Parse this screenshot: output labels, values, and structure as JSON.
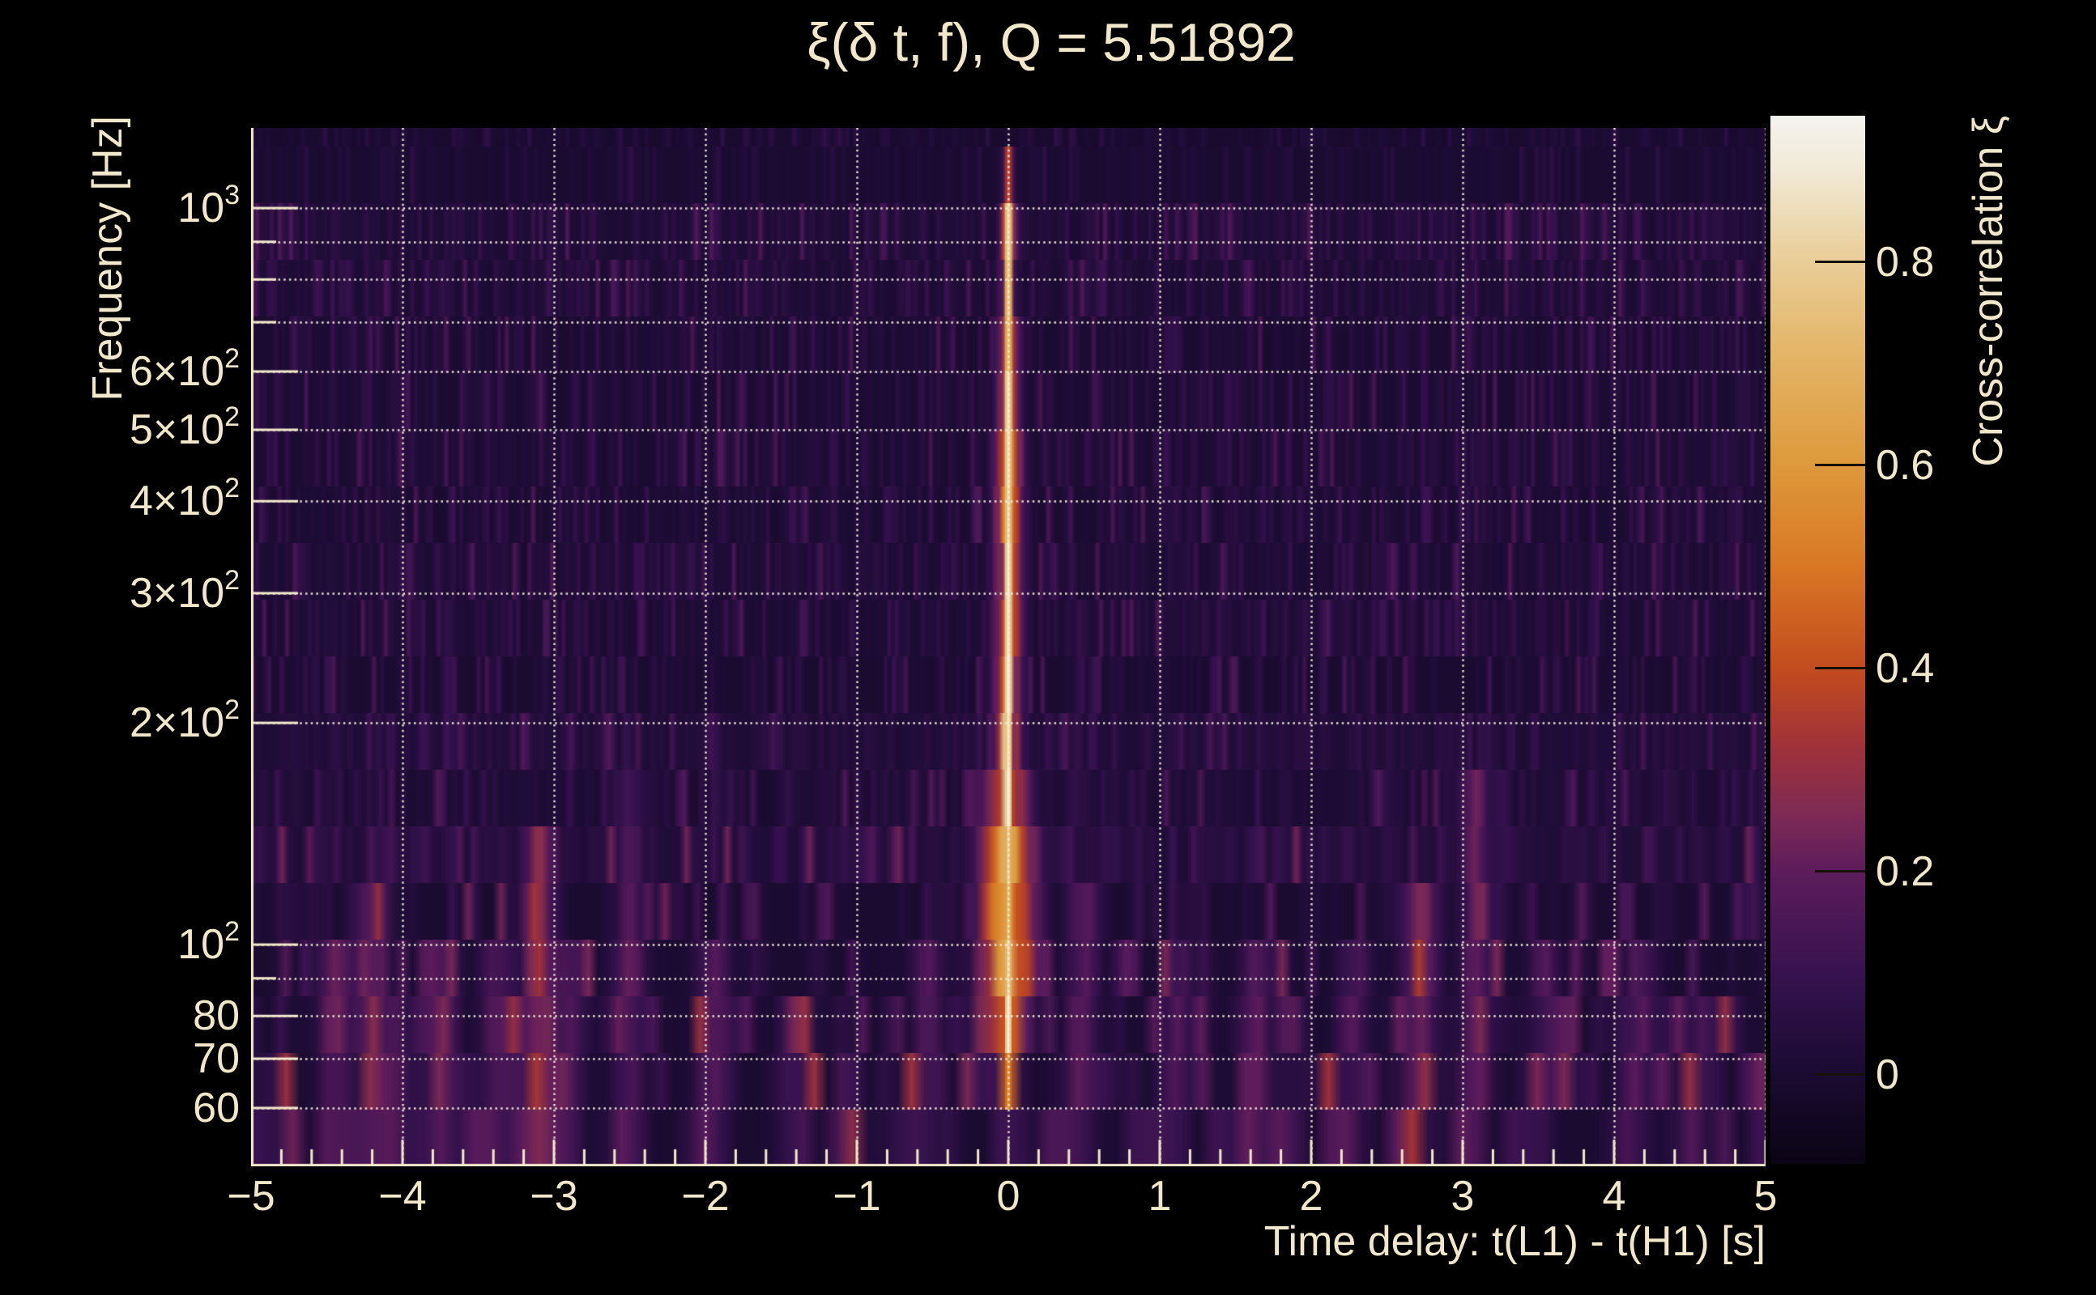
{
  "title": {
    "text": "ξ(δ t, f), Q = 5.51892"
  },
  "axes": {
    "x": {
      "label": "Time delay: t(L1) - t(H1) [s]",
      "range": [
        -5,
        5
      ],
      "minor_step": 0.2,
      "ticks": [
        {
          "label": "−5",
          "value": -5
        },
        {
          "label": "−4",
          "value": -4
        },
        {
          "label": "−3",
          "value": -3
        },
        {
          "label": "−2",
          "value": -2
        },
        {
          "label": "−1",
          "value": -1
        },
        {
          "label": "0",
          "value": 0
        },
        {
          "label": "1",
          "value": 1
        },
        {
          "label": "2",
          "value": 2
        },
        {
          "label": "3",
          "value": 3
        },
        {
          "label": "4",
          "value": 4
        },
        {
          "label": "5",
          "value": 5
        }
      ]
    },
    "y": {
      "label": "Frequency [Hz]",
      "scale": "log",
      "range_hz": [
        50,
        1285
      ],
      "tick_labels": [
        {
          "text": "10",
          "exp": "3",
          "value": 1000
        },
        {
          "text": "6×10",
          "exp": "2",
          "value": 600
        },
        {
          "text": "5×10",
          "exp": "2",
          "value": 500
        },
        {
          "text": "4×10",
          "exp": "2",
          "value": 400
        },
        {
          "text": "3×10",
          "exp": "2",
          "value": 300
        },
        {
          "text": "2×10",
          "exp": "2",
          "value": 200
        },
        {
          "text": "10",
          "exp": "2",
          "value": 100
        },
        {
          "text": "80",
          "value": 80
        },
        {
          "text": "70",
          "value": 70
        },
        {
          "text": "60",
          "value": 60
        }
      ],
      "grid_values": [
        60,
        70,
        80,
        90,
        100,
        200,
        300,
        400,
        500,
        600,
        700,
        800,
        900,
        1000
      ]
    }
  },
  "colorbar": {
    "title": "Cross-correlation ξ",
    "range": [
      -0.088,
      0.944
    ],
    "ticks": [
      {
        "label": "0.8",
        "value": 0.8
      },
      {
        "label": "0.6",
        "value": 0.6
      },
      {
        "label": "0.4",
        "value": 0.4
      },
      {
        "label": "0.2",
        "value": 0.2
      },
      {
        "label": "0",
        "value": 0
      }
    ],
    "colormap": [
      [
        0.0,
        "#0a0414"
      ],
      [
        0.1,
        "#1e0c36"
      ],
      [
        0.18,
        "#36124e"
      ],
      [
        0.28,
        "#5d1c5c"
      ],
      [
        0.33,
        "#7c2a55"
      ],
      [
        0.4,
        "#a03239"
      ],
      [
        0.47,
        "#c24b1f"
      ],
      [
        0.57,
        "#d97724"
      ],
      [
        0.67,
        "#de9a3c"
      ],
      [
        0.77,
        "#e3b466"
      ],
      [
        0.86,
        "#e9cd96"
      ],
      [
        0.95,
        "#f1ead8"
      ],
      [
        1.0,
        "#f5f3ef"
      ]
    ]
  },
  "chart_data": {
    "type": "heatmap",
    "title": "ξ(δ t, f), Q = 5.51892",
    "q_value": 5.51892,
    "xlabel": "Time delay: t(L1) - t(H1) [s]",
    "ylabel": "Frequency [Hz]",
    "x_range_s": [
      -5,
      5
    ],
    "y_range_hz": [
      50,
      1285
    ],
    "y_scale": "log",
    "z_label": "Cross-correlation ξ",
    "z_range": [
      -0.088,
      0.944
    ],
    "grid": "dotted, at integer time delays and decade-multiple frequencies",
    "colormap_name": "black→purple→magenta→red→orange→tan→cream (inferno-like)",
    "rows_per_decade_log_step": 0.0769,
    "main_peak": {
      "t": 0.0,
      "xi_max": 0.93,
      "core_half_width_s": 0.025,
      "f_core_hz": [
        70,
        950
      ],
      "f_faint_hz": [
        950,
        1150
      ],
      "halo": [
        {
          "f_lt": 160,
          "w": 0.17,
          "amp": 0.42
        },
        {
          "f_lt": 350,
          "w": 0.11,
          "amp": 0.4
        },
        {
          "f_lt": 700,
          "w": 0.085,
          "amp": 0.38
        },
        {
          "f_lt": 2000,
          "w": 0.055,
          "amp": 0.28
        }
      ],
      "bright_bands_hz": [
        [
          90,
          140
        ],
        [
          380,
          520
        ],
        [
          800,
          950
        ]
      ]
    },
    "noise_floor": {
      "xi_typical": [
        0.0,
        0.15
      ],
      "low_freq_boost_below_hz": 160
    },
    "secondary_stripes": [
      {
        "t": -4.45,
        "amp": 0.3,
        "f_max": 100
      },
      {
        "t": -4.2,
        "amp": 0.34,
        "f_max": 115
      },
      {
        "t": -4.05,
        "amp": 0.26,
        "f_max": 85
      },
      {
        "t": -3.75,
        "amp": 0.28,
        "f_max": 100
      },
      {
        "t": -3.37,
        "amp": 0.24,
        "f_max": 90
      },
      {
        "t": -3.1,
        "amp": 0.42,
        "f_max": 130
      },
      {
        "t": -2.92,
        "amp": 0.27,
        "f_max": 95
      },
      {
        "t": -2.5,
        "amp": 0.22,
        "f_max": 160
      },
      {
        "t": -1.95,
        "amp": 0.24,
        "f_max": 90
      },
      {
        "t": -1.38,
        "amp": 0.2,
        "f_max": 85
      },
      {
        "t": -0.52,
        "amp": 0.22,
        "f_max": 100
      },
      {
        "t": 0.5,
        "amp": 0.26,
        "f_max": 110
      },
      {
        "t": 1.12,
        "amp": 0.2,
        "f_max": 90
      },
      {
        "t": 1.65,
        "amp": 0.22,
        "f_max": 95
      },
      {
        "t": 2.3,
        "amp": 0.2,
        "f_max": 90
      },
      {
        "t": 2.72,
        "amp": 0.38,
        "f_max": 110
      },
      {
        "t": 3.1,
        "amp": 0.3,
        "f_max": 150
      },
      {
        "t": 3.55,
        "amp": 0.2,
        "f_max": 90
      },
      {
        "t": 4.18,
        "amp": 0.22,
        "f_max": 95
      },
      {
        "t": 4.6,
        "amp": 0.2,
        "f_max": 85
      }
    ]
  },
  "layout_colors": {
    "background": "#000000",
    "text": "#f1e7ca",
    "axis": "#f2e8cb",
    "grid": "#f8f2e0",
    "colorbar_tick": "#171007"
  }
}
